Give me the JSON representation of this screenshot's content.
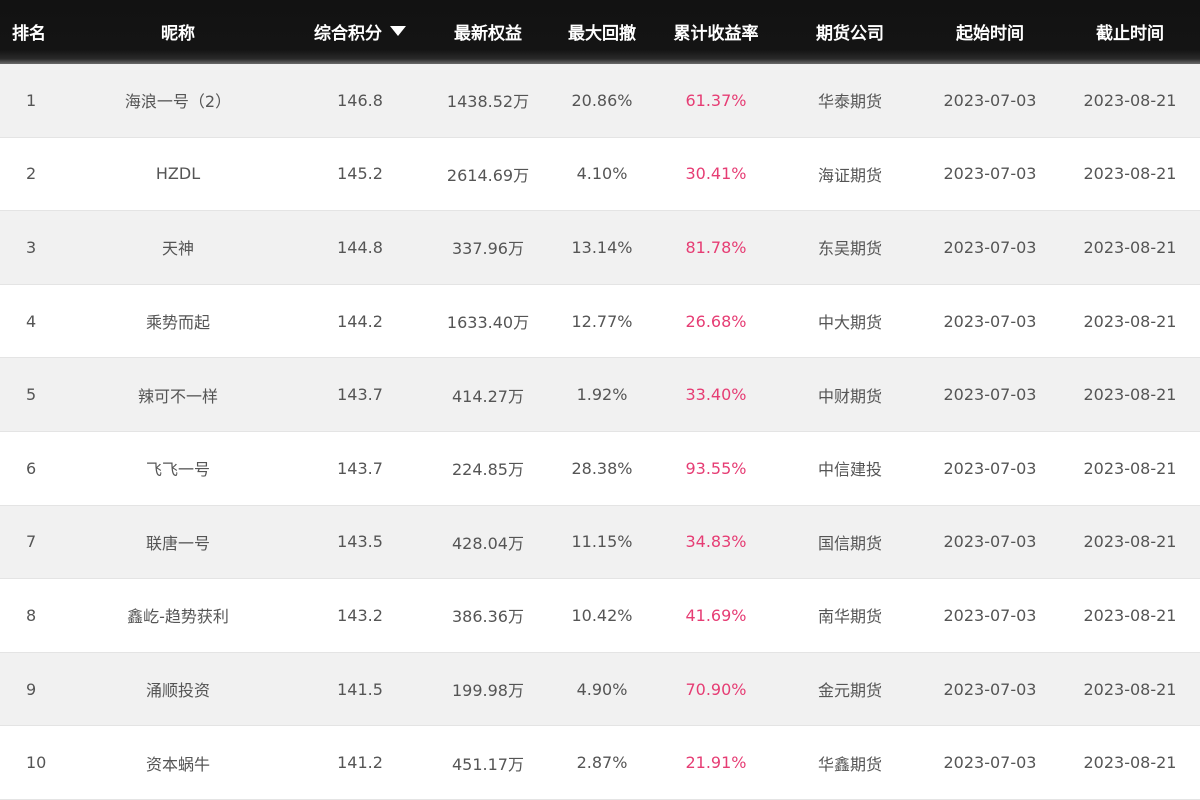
{
  "headers": {
    "rank": "排名",
    "name": "昵称",
    "score": "综合积分",
    "equity": "最新权益",
    "drawdown": "最大回撤",
    "return": "累计收益率",
    "firm": "期货公司",
    "start": "起始时间",
    "end": "截止时间"
  },
  "sort": {
    "column": "score",
    "direction": "desc",
    "icon": "sort-desc-triangle"
  },
  "colors": {
    "header_bg": "#141414",
    "header_text": "#ffffff",
    "row_alt_bg": "#f1f1f1",
    "row_bg": "#ffffff",
    "text": "#555555",
    "return_text": "#e63d74"
  },
  "rows": [
    {
      "rank": "1",
      "name": "海浪一号（2）",
      "score": "146.8",
      "equity": "1438.52万",
      "drawdown": "20.86%",
      "return": "61.37%",
      "firm": "华泰期货",
      "start": "2023-07-03",
      "end": "2023-08-21"
    },
    {
      "rank": "2",
      "name": "HZDL",
      "score": "145.2",
      "equity": "2614.69万",
      "drawdown": "4.10%",
      "return": "30.41%",
      "firm": "海证期货",
      "start": "2023-07-03",
      "end": "2023-08-21"
    },
    {
      "rank": "3",
      "name": "天神",
      "score": "144.8",
      "equity": "337.96万",
      "drawdown": "13.14%",
      "return": "81.78%",
      "firm": "东吴期货",
      "start": "2023-07-03",
      "end": "2023-08-21"
    },
    {
      "rank": "4",
      "name": "乘势而起",
      "score": "144.2",
      "equity": "1633.40万",
      "drawdown": "12.77%",
      "return": "26.68%",
      "firm": "中大期货",
      "start": "2023-07-03",
      "end": "2023-08-21"
    },
    {
      "rank": "5",
      "name": "辣可不一样",
      "score": "143.7",
      "equity": "414.27万",
      "drawdown": "1.92%",
      "return": "33.40%",
      "firm": "中财期货",
      "start": "2023-07-03",
      "end": "2023-08-21"
    },
    {
      "rank": "6",
      "name": "飞飞一号",
      "score": "143.7",
      "equity": "224.85万",
      "drawdown": "28.38%",
      "return": "93.55%",
      "firm": "中信建投",
      "start": "2023-07-03",
      "end": "2023-08-21"
    },
    {
      "rank": "7",
      "name": "联唐一号",
      "score": "143.5",
      "equity": "428.04万",
      "drawdown": "11.15%",
      "return": "34.83%",
      "firm": "国信期货",
      "start": "2023-07-03",
      "end": "2023-08-21"
    },
    {
      "rank": "8",
      "name": "鑫屹-趋势获利",
      "score": "143.2",
      "equity": "386.36万",
      "drawdown": "10.42%",
      "return": "41.69%",
      "firm": "南华期货",
      "start": "2023-07-03",
      "end": "2023-08-21"
    },
    {
      "rank": "9",
      "name": "涌顺投资",
      "score": "141.5",
      "equity": "199.98万",
      "drawdown": "4.90%",
      "return": "70.90%",
      "firm": "金元期货",
      "start": "2023-07-03",
      "end": "2023-08-21"
    },
    {
      "rank": "10",
      "name": "资本蜗牛",
      "score": "141.2",
      "equity": "451.17万",
      "drawdown": "2.87%",
      "return": "21.91%",
      "firm": "华鑫期货",
      "start": "2023-07-03",
      "end": "2023-08-21"
    }
  ]
}
